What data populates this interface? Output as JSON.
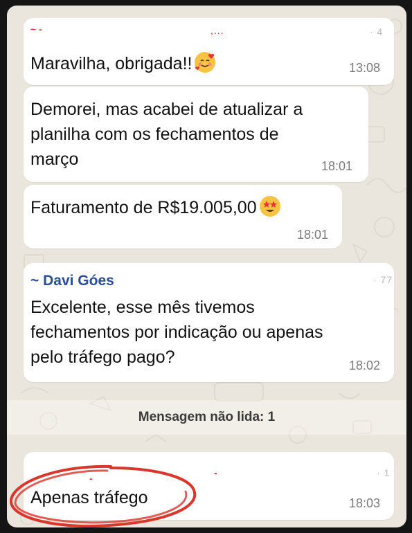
{
  "messages": [
    {
      "text": "Maravilha, obrigada!!",
      "time": "13:08",
      "emoji": "smiling-face-with-hearts-icon"
    },
    {
      "text_lines": [
        "Demorei, mas acabei de atualizar a",
        "planilha com os fechamentos de",
        "março"
      ],
      "time": "18:01"
    },
    {
      "text": "Faturamento de R$19.005,00",
      "time": "18:01",
      "emoji": "star-struck-icon"
    },
    {
      "sender": "~ Davi Góes",
      "text_lines": [
        "Excelente, esse mês tivemos",
        "fechamentos por indicação ou apenas",
        "pelo tráfego pago?"
      ],
      "time": "18:02"
    },
    {
      "text": "Apenas tráfego",
      "time": "18:03"
    }
  ],
  "unread_label": "Mensagem não lida: 1",
  "colors": {
    "chat_background": "#ebe6dd",
    "bubble": "#ffffff",
    "sender_name": "#2a4e9c",
    "highlight_circle": "#d9362c"
  }
}
